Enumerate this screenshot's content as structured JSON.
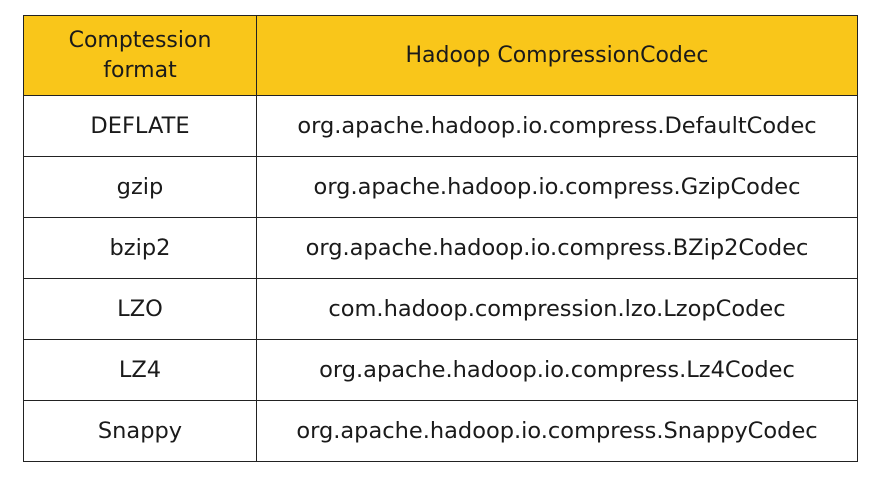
{
  "table": {
    "headers": {
      "format": "Comptession format",
      "codec": "Hadoop CompressionCodec"
    },
    "rows": [
      {
        "format": "DEFLATE",
        "codec": "org.apache.hadoop.io.compress.DefaultCodec"
      },
      {
        "format": "gzip",
        "codec": "org.apache.hadoop.io.compress.GzipCodec"
      },
      {
        "format": "bzip2",
        "codec": "org.apache.hadoop.io.compress.BZip2Codec"
      },
      {
        "format": "LZO",
        "codec": "com.hadoop.compression.lzo.LzopCodec"
      },
      {
        "format": "LZ4",
        "codec": "org.apache.hadoop.io.compress.Lz4Codec"
      },
      {
        "format": "Snappy",
        "codec": "org.apache.hadoop.io.compress.SnappyCodec"
      }
    ],
    "colors": {
      "header_background": "#f9c61a",
      "border": "#222222",
      "text": "#1a1a1a"
    }
  }
}
